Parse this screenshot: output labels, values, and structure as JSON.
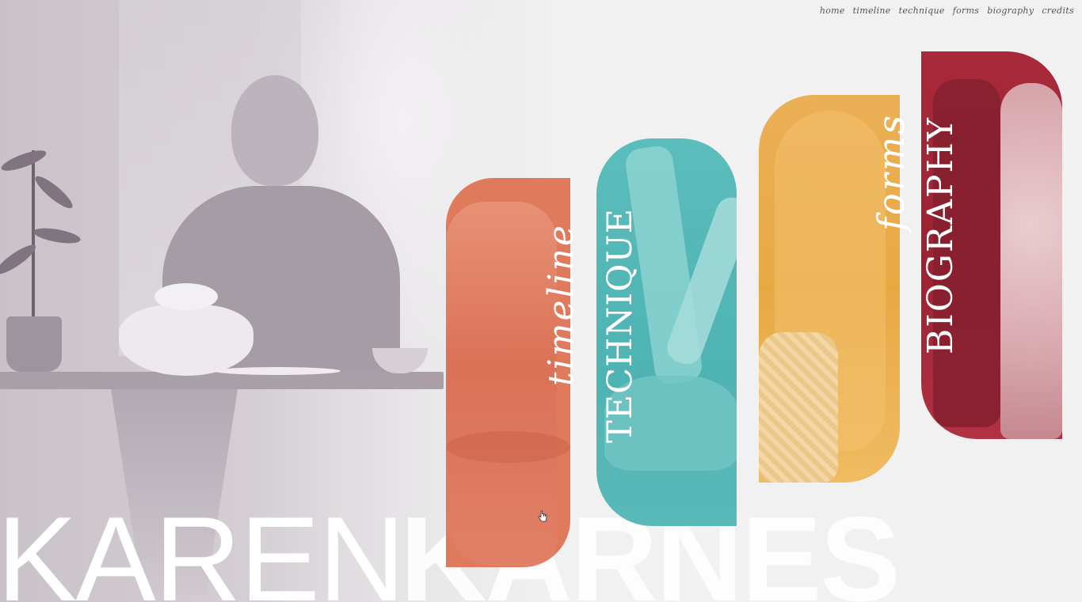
{
  "nav": {
    "items": [
      {
        "label": "home"
      },
      {
        "label": "timeline"
      },
      {
        "label": "technique"
      },
      {
        "label": "forms"
      },
      {
        "label": "biography"
      },
      {
        "label": "credits"
      }
    ]
  },
  "title": {
    "first": "KAREN",
    "last": "KARNES"
  },
  "sections": {
    "timeline": {
      "label": "timeline",
      "color": "#e07a5c"
    },
    "technique": {
      "label": "TECHNIQUE",
      "color": "#4fb3b3"
    },
    "forms": {
      "label": "forms",
      "color": "#e8a944"
    },
    "biography": {
      "label": "BIOGRAPHY",
      "color": "#9b2233"
    }
  },
  "colors": {
    "background": "#f1f1f1",
    "nav_text": "#555555"
  },
  "icons": {
    "cursor": "hand-pointer-icon"
  }
}
